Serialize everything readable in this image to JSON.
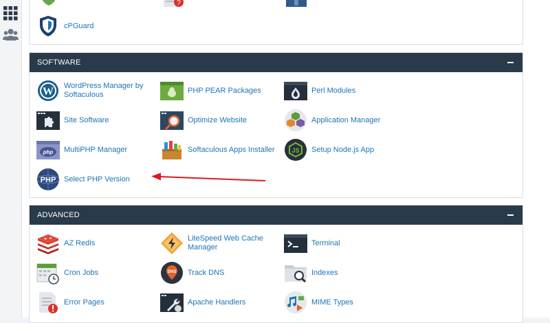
{
  "security": {
    "cpguard_label": "cPGuard"
  },
  "software": {
    "title": "SOFTWARE",
    "items": [
      {
        "label": "WordPress Manager by Softaculous",
        "icon": "wordpress-icon"
      },
      {
        "label": "PHP PEAR Packages",
        "icon": "pear-icon"
      },
      {
        "label": "Perl Modules",
        "icon": "perl-onion-icon"
      },
      {
        "label": "Site Software",
        "icon": "puzzle-icon"
      },
      {
        "label": "Optimize Website",
        "icon": "magnifier-icon"
      },
      {
        "label": "Application Manager",
        "icon": "cubes-icon"
      },
      {
        "label": "MultiPHP Manager",
        "icon": "php-window-icon"
      },
      {
        "label": "Softaculous Apps Installer",
        "icon": "softaculous-icon"
      },
      {
        "label": "Setup Node.js App",
        "icon": "nodejs-icon"
      },
      {
        "label": "Select PHP Version",
        "icon": "php-globe-icon"
      }
    ]
  },
  "advanced": {
    "title": "ADVANCED",
    "items": [
      {
        "label": "AZ Redis",
        "icon": "redis-icon"
      },
      {
        "label": "LiteSpeed Web Cache Manager",
        "icon": "litespeed-icon"
      },
      {
        "label": "Terminal",
        "icon": "terminal-icon"
      },
      {
        "label": "Cron Jobs",
        "icon": "calendar-clock-icon"
      },
      {
        "label": "Track DNS",
        "icon": "dns-pin-icon"
      },
      {
        "label": "Indexes",
        "icon": "folder-search-icon"
      },
      {
        "label": "Error Pages",
        "icon": "document-error-icon"
      },
      {
        "label": "Apache Handlers",
        "icon": "window-wrench-icon"
      },
      {
        "label": "MIME Types",
        "icon": "media-files-icon"
      }
    ]
  },
  "colors": {
    "header_bg": "#293a4a",
    "link": "#1d74b8",
    "annotation_arrow": "#e0191b"
  }
}
